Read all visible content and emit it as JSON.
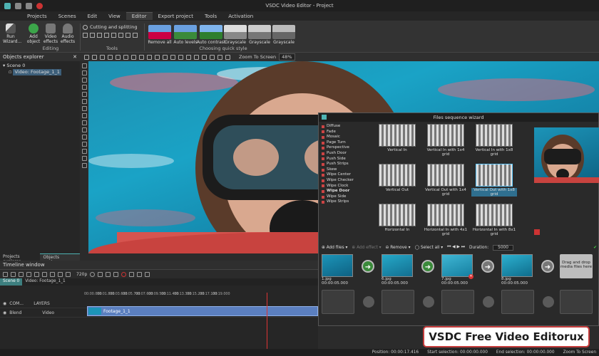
{
  "window": {
    "title": "VSDC Video Editor - Project"
  },
  "menu": [
    {
      "label": "Projects"
    },
    {
      "label": "Scenes"
    },
    {
      "label": "Edit"
    },
    {
      "label": "View"
    },
    {
      "label": "Editor",
      "active": true
    },
    {
      "label": "Export project"
    },
    {
      "label": "Tools"
    },
    {
      "label": "Activation"
    }
  ],
  "ribbon": {
    "run_wizard": "Run Wizard...",
    "editing_group": "Editing",
    "add_object": "Add object",
    "video_effects": "Video effects",
    "audio_effects": "Audio effects",
    "cutting": "Cutting and splitting",
    "tools_group": "Tools",
    "quick_style_group": "Choosing quick style",
    "styles": [
      "Remove all",
      "Auto levels",
      "Auto contrast",
      "Grayscale",
      "Grayscale",
      "Grayscale"
    ]
  },
  "toolbar": {
    "zoom_label": "Zoom To Screen",
    "zoom_value": "48%"
  },
  "objects_explorer": {
    "title": "Objects explorer",
    "tree": [
      "Scene 0",
      "Video: Footage_1_1"
    ],
    "tabs": [
      "Projects explorer",
      "Objects explorer"
    ]
  },
  "wizard": {
    "title": "Files sequence wizard",
    "transitions": [
      "Diffuse",
      "Fade",
      "Mosaic",
      "Page Turn",
      "Perspective",
      "Push Door",
      "Push Side",
      "Push Strips",
      "Skew",
      "Wipe Center",
      "Wipe Checker",
      "Wipe Clock",
      "Wipe Door",
      "Wipe Side",
      "Wipe Strips"
    ],
    "active_transition": "Wipe Door",
    "thumbnails": [
      "Vertical In",
      "Vertical In with 1x4 grid",
      "Vertical In with 1x8 grid",
      "Vertical Out",
      "Vertical Out with 1x4 grid",
      "Vertical Out with 1x8 grid",
      "Horizontal In",
      "Horizontal In with 4x1 grid",
      "Horizontal In with 8x1 grid"
    ],
    "selected_thumbnail": "Vertical Out with 1x8 grid",
    "buttons": {
      "add_files": "Add files",
      "add_effect": "Add effect",
      "remove": "Remove",
      "select_all": "Select all",
      "duration_label": "Duration:",
      "duration_value": "5000"
    },
    "files": [
      {
        "name": "1.jpg",
        "time": "00:00:05.000"
      },
      {
        "name": "6.jpg",
        "time": "00:00:05.000"
      },
      {
        "name": "7.jpg",
        "time": "00:00:05.000"
      },
      {
        "name": "8.jpg",
        "time": "00:00:05.000"
      }
    ],
    "drop_text": "Drag and drop media files here"
  },
  "timeline": {
    "title": "Timeline window",
    "quality": "720p",
    "tabs": [
      "Scene 0",
      "Video: Footage_1_1"
    ],
    "ruler": [
      "00:00.000",
      "00:01.800",
      "00:03.600",
      "00:05.700",
      "00:07.600",
      "00:09.500",
      "00:11.400",
      "00:13.300",
      "00:15.200",
      "00:17.100",
      "00:19.000"
    ],
    "rows": [
      {
        "label": "COM...",
        "sub": "LAYERS"
      },
      {
        "label": "Blend",
        "sub": "Video"
      }
    ],
    "clip": "Footage_1_1"
  },
  "status": {
    "position_label": "Position:",
    "position": "00:00:17.416",
    "start_label": "Start selection:",
    "start": "00:00:00.000",
    "end_label": "End selection:",
    "end": "00:00:00.000",
    "zoom": "Zoom To Screen"
  },
  "watermark": "VSDC Free Video Editorux",
  "colors": {
    "accent": "#4fb3b3",
    "water": "#1aa3c6",
    "clip": "#5b7fbf",
    "watermark_border": "#c43b3b"
  }
}
